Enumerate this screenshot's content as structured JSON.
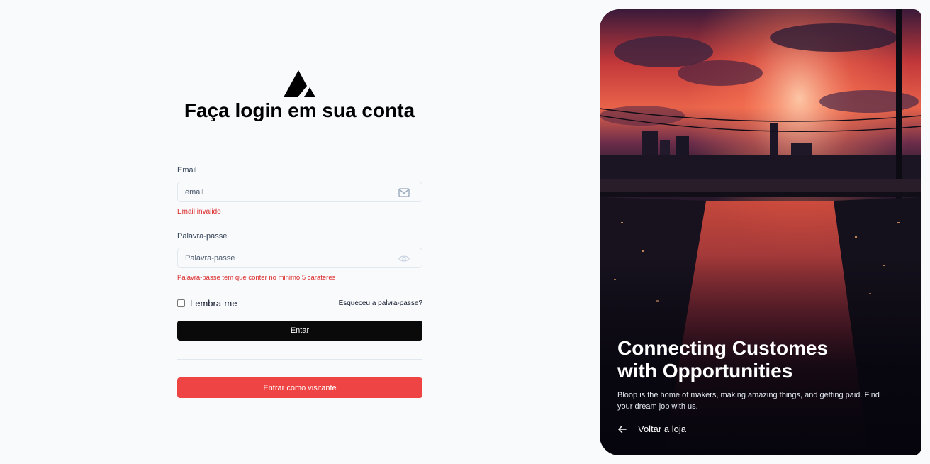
{
  "brand": {
    "logo_icon": "triangle-logo-icon"
  },
  "login": {
    "title": "Faça login em sua conta",
    "email": {
      "label": "Email",
      "placeholder": "email",
      "value": "",
      "icon": "mail-icon",
      "error": "Email invalido"
    },
    "password": {
      "label": "Palavra-passe",
      "placeholder": "Palavra-passe",
      "value": "",
      "icon": "eye-icon",
      "error": "Palavra-passe tem que conter no minimo 5 carateres"
    },
    "remember_label": "Lembra-me",
    "remember_checked": false,
    "forgot_label": "Esqueceu a palvra-passe?",
    "submit_label": "Entar",
    "guest_label": "Entrar como visitante",
    "colors": {
      "submit_bg": "#0a0a0a",
      "guest_bg": "#ef4444",
      "error": "#dc2626"
    }
  },
  "hero": {
    "heading_line1": "Connecting Customes",
    "heading_line2": "with Opportunities",
    "description": "Bloop is the home of makers, making amazing things, and getting paid. Find your dream job with us.",
    "back_label": "Voltar a loja",
    "back_icon": "arrow-left-icon"
  }
}
